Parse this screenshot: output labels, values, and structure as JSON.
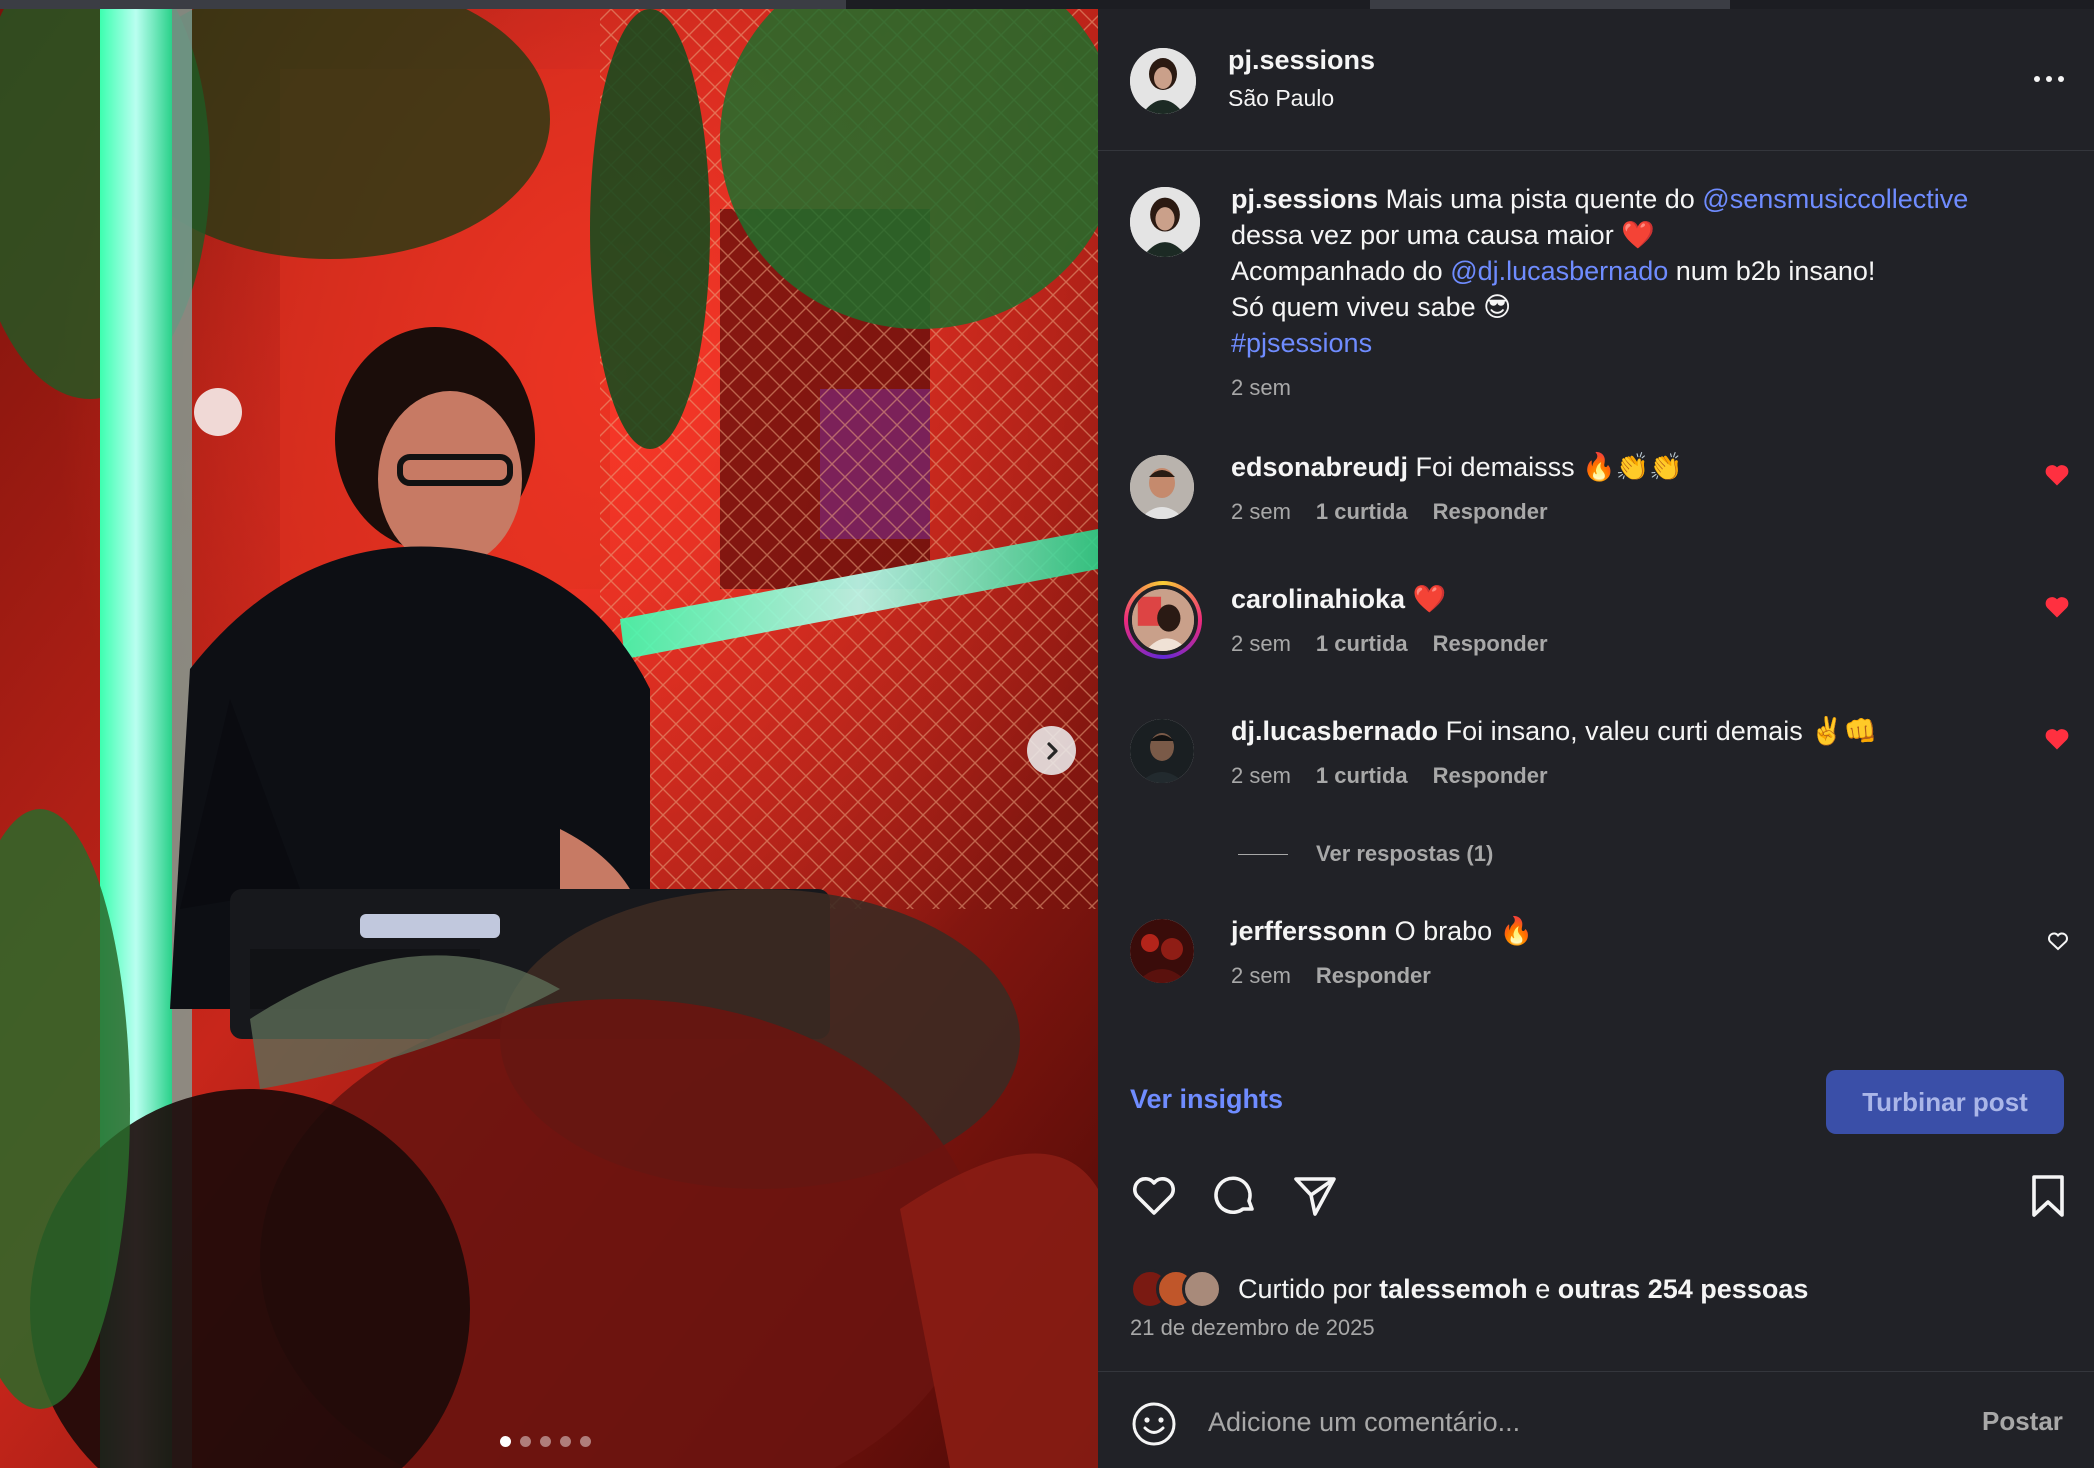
{
  "post": {
    "username": "pj.sessions",
    "location": "São Paulo",
    "more_icon": "more-horizontal-icon",
    "media": {
      "carousel_count": 5,
      "active_index": 0,
      "next_icon": "chevron-right-icon"
    }
  },
  "caption": {
    "username": "pj.sessions",
    "line1_text": "Mais uma pista quente do",
    "line1_mention": "@sensmusiccollective",
    "line2_text": "dessa vez por uma causa maior",
    "line2_emoji": "❤️",
    "line3_pre": "Acompanhado do",
    "line3_mention": "@dj.lucasbernado",
    "line3_post": "num b2b insano!",
    "line4_text": "Só quem viveu sabe",
    "line4_emoji": "😎",
    "hashtag": "#pjsessions",
    "time": "2 sem"
  },
  "comments": [
    {
      "username": "edsonabreudj",
      "text": "Foi demaisss",
      "emoji": "🔥👏👏",
      "time": "2 sem",
      "likes": "1 curtida",
      "reply": "Responder",
      "liked": true
    },
    {
      "username": "carolinahioka",
      "text": "",
      "emoji": "❤️",
      "time": "2 sem",
      "likes": "1 curtida",
      "reply": "Responder",
      "liked": true
    },
    {
      "username": "dj.lucasbernado",
      "text": "Foi insano, valeu curti demais",
      "emoji": "✌️👊",
      "time": "2 sem",
      "likes": "1 curtida",
      "reply": "Responder",
      "liked": true
    },
    {
      "username": "jerfferssonn",
      "text": "O brabo",
      "emoji": "🔥",
      "time": "2 sem",
      "likes": "",
      "reply": "Responder",
      "liked": false
    }
  ],
  "view_replies": "Ver respostas (1)",
  "insights_label": "Ver insights",
  "boost_label": "Turbinar post",
  "likes": {
    "prefix": "Curtido por",
    "user": "talessemoh",
    "connector": "e",
    "others": "outras 254 pessoas"
  },
  "date": "21 de dezembro de 2025",
  "add_comment": {
    "placeholder": "Adicione um comentário...",
    "post_label": "Postar"
  },
  "colors": {
    "panel_bg": "#212227",
    "link": "#6f8cff",
    "like_red": "#ff3040",
    "button_blue": "#3a4fa8"
  }
}
